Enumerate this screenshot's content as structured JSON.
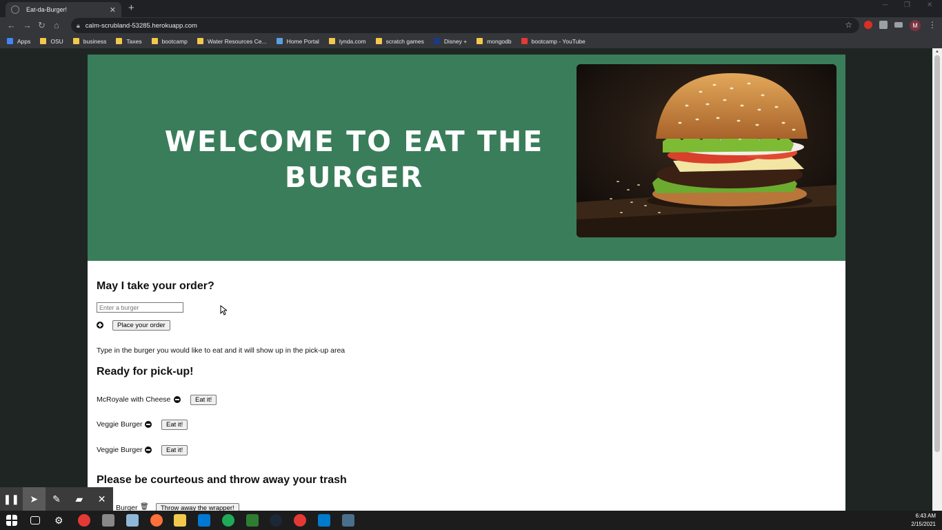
{
  "browser": {
    "tab_title": "Eat-da-Burger!",
    "tab_close": "✕",
    "new_tab": "+",
    "url": "calm-scrubland-53285.herokuapp.com",
    "profile_initial": "M",
    "bookmarks": [
      {
        "label": "Apps",
        "color": "#4285f4"
      },
      {
        "label": "OSU",
        "color": "#f2c94c"
      },
      {
        "label": "business",
        "color": "#f2c94c"
      },
      {
        "label": "Taxes",
        "color": "#f2c94c"
      },
      {
        "label": "bootcamp",
        "color": "#f2c94c"
      },
      {
        "label": "Water Resources Ce...",
        "color": "#f2c94c"
      },
      {
        "label": "Home Portal",
        "color": "#5aa0e0"
      },
      {
        "label": "lynda.com",
        "color": "#f2c94c"
      },
      {
        "label": "scratch games",
        "color": "#f2c94c"
      },
      {
        "label": "Disney +",
        "color": "#1a3a8a"
      },
      {
        "label": "mongodb",
        "color": "#f2c94c"
      },
      {
        "label": "bootcamp - YouTube",
        "color": "#e53935"
      }
    ]
  },
  "hero": {
    "heading": "WELCOME TO EAT THE BURGER"
  },
  "order": {
    "heading": "May I take your order?",
    "input_placeholder": "Enter a burger",
    "submit_label": "Place your order",
    "hint": "Type in the burger you would like to eat and it will show up in the pick-up area"
  },
  "pickup": {
    "heading": "Ready for pick-up!",
    "items": [
      {
        "name": "McRoyale with Cheese",
        "button": "Eat it!"
      },
      {
        "name": "Veggie Burger",
        "button": "Eat it!"
      },
      {
        "name": "Veggie Burger",
        "button": "Eat it!"
      }
    ]
  },
  "trash": {
    "heading": "Please be courteous and throw away your trash",
    "items": [
      {
        "name": "Burger",
        "button": "Throw away the wrapper!"
      }
    ]
  },
  "taskbar": {
    "time": "6:43 AM",
    "date": "2/15/2021"
  }
}
